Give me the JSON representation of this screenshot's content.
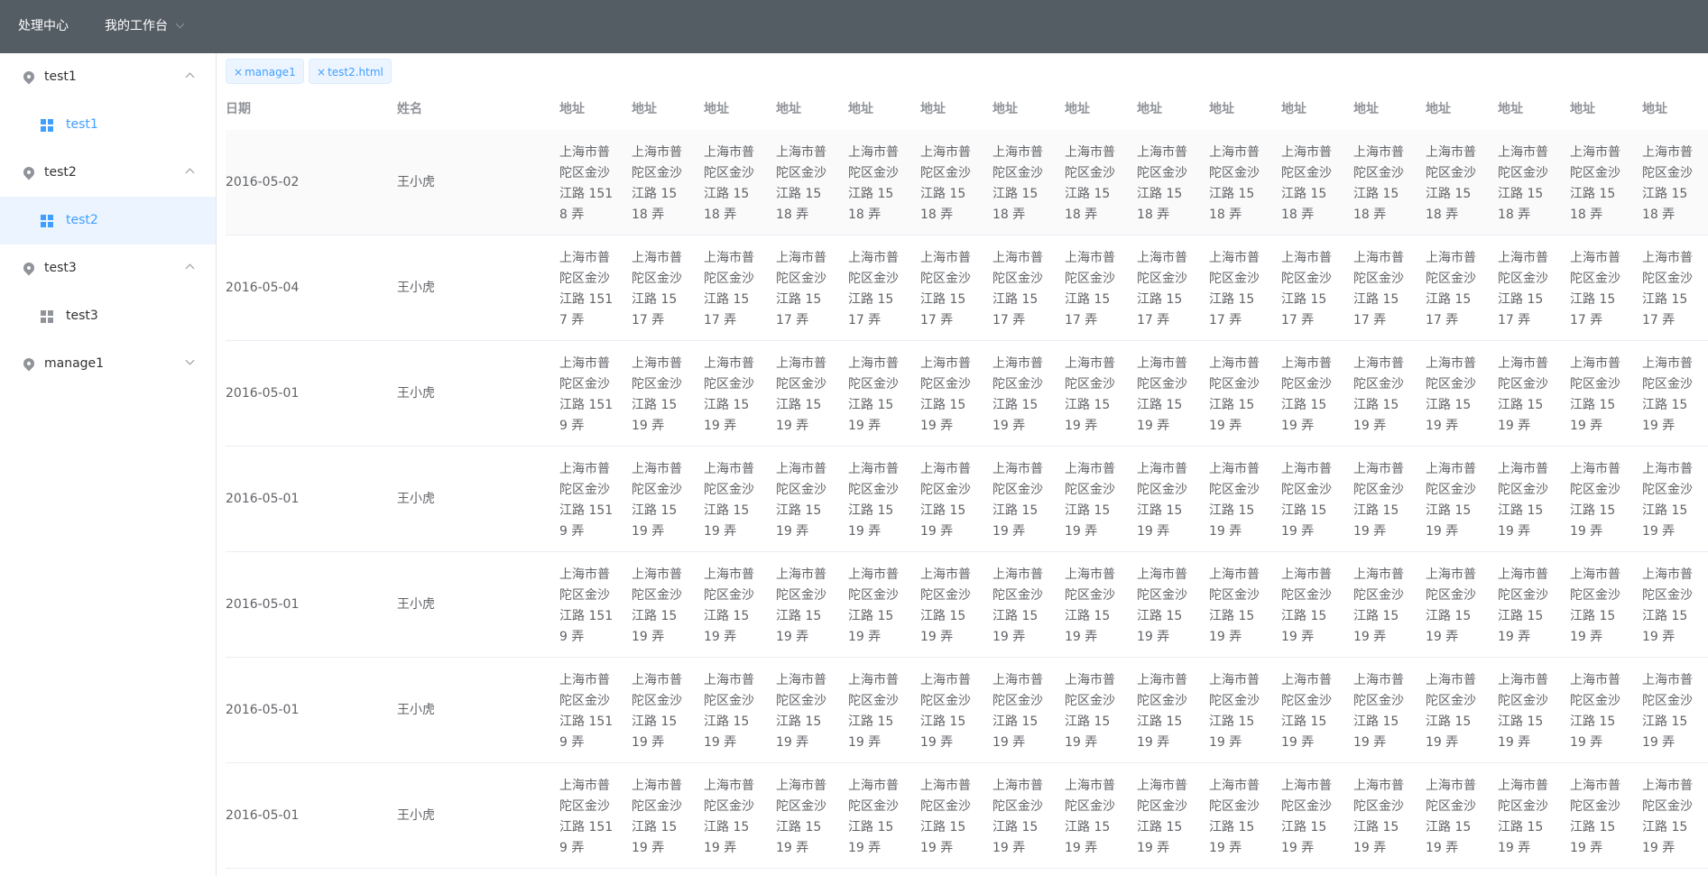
{
  "topnav": {
    "title": "处理中心",
    "workbench": "我的工作台"
  },
  "sidebar": {
    "groups": [
      {
        "label": "test1",
        "expanded": true,
        "items": [
          {
            "label": "test1",
            "active": false,
            "highlighted": true
          }
        ]
      },
      {
        "label": "test2",
        "expanded": true,
        "items": [
          {
            "label": "test2",
            "active": true,
            "highlighted": true
          }
        ]
      },
      {
        "label": "test3",
        "expanded": true,
        "items": [
          {
            "label": "test3",
            "active": false,
            "highlighted": false
          }
        ]
      },
      {
        "label": "manage1",
        "expanded": false,
        "items": []
      }
    ]
  },
  "tabs": [
    {
      "label": "manage1",
      "close_icon": "×"
    },
    {
      "label": "test2.html",
      "close_icon": "×"
    }
  ],
  "table": {
    "headers": {
      "date": "日期",
      "name": "姓名",
      "address": [
        "地址",
        "地址",
        "地址",
        "地址",
        "地址",
        "地址",
        "地址",
        "地址",
        "地址",
        "地址",
        "地址",
        "地址",
        "地址",
        "地址",
        "地址",
        "地址"
      ]
    },
    "rows": [
      {
        "date": "2016-05-02",
        "name": "王小虎",
        "address": [
          "上海市普陀区金沙江路 1518 弄",
          "上海市普陀区金沙江路 1518 弄",
          "上海市普陀区金沙江路 1518 弄",
          "上海市普陀区金沙江路 1518 弄",
          "上海市普陀区金沙江路 1518 弄",
          "上海市普陀区金沙江路 1518 弄",
          "上海市普陀区金沙江路 1518 弄",
          "上海市普陀区金沙江路 1518 弄",
          "上海市普陀区金沙江路 1518 弄",
          "上海市普陀区金沙江路 1518 弄",
          "上海市普陀区金沙江路 1518 弄",
          "上海市普陀区金沙江路 1518 弄",
          "上海市普陀区金沙江路 1518 弄",
          "上海市普陀区金沙江路 1518 弄",
          "上海市普陀区金沙江路 1518 弄",
          "上海市普陀区金沙江路 1518 弄"
        ]
      },
      {
        "date": "2016-05-04",
        "name": "王小虎",
        "address": [
          "上海市普陀区金沙江路 1517 弄",
          "上海市普陀区金沙江路 1517 弄",
          "上海市普陀区金沙江路 1517 弄",
          "上海市普陀区金沙江路 1517 弄",
          "上海市普陀区金沙江路 1517 弄",
          "上海市普陀区金沙江路 1517 弄",
          "上海市普陀区金沙江路 1517 弄",
          "上海市普陀区金沙江路 1517 弄",
          "上海市普陀区金沙江路 1517 弄",
          "上海市普陀区金沙江路 1517 弄",
          "上海市普陀区金沙江路 1517 弄",
          "上海市普陀区金沙江路 1517 弄",
          "上海市普陀区金沙江路 1517 弄",
          "上海市普陀区金沙江路 1517 弄",
          "上海市普陀区金沙江路 1517 弄",
          "上海市普陀区金沙江路 1517 弄"
        ]
      },
      {
        "date": "2016-05-01",
        "name": "王小虎",
        "address": [
          "上海市普陀区金沙江路 1519 弄",
          "上海市普陀区金沙江路 1519 弄",
          "上海市普陀区金沙江路 1519 弄",
          "上海市普陀区金沙江路 1519 弄",
          "上海市普陀区金沙江路 1519 弄",
          "上海市普陀区金沙江路 1519 弄",
          "上海市普陀区金沙江路 1519 弄",
          "上海市普陀区金沙江路 1519 弄",
          "上海市普陀区金沙江路 1519 弄",
          "上海市普陀区金沙江路 1519 弄",
          "上海市普陀区金沙江路 1519 弄",
          "上海市普陀区金沙江路 1519 弄",
          "上海市普陀区金沙江路 1519 弄",
          "上海市普陀区金沙江路 1519 弄",
          "上海市普陀区金沙江路 1519 弄",
          "上海市普陀区金沙江路 1519 弄"
        ]
      },
      {
        "date": "2016-05-01",
        "name": "王小虎",
        "address": [
          "上海市普陀区金沙江路 1519 弄",
          "上海市普陀区金沙江路 1519 弄",
          "上海市普陀区金沙江路 1519 弄",
          "上海市普陀区金沙江路 1519 弄",
          "上海市普陀区金沙江路 1519 弄",
          "上海市普陀区金沙江路 1519 弄",
          "上海市普陀区金沙江路 1519 弄",
          "上海市普陀区金沙江路 1519 弄",
          "上海市普陀区金沙江路 1519 弄",
          "上海市普陀区金沙江路 1519 弄",
          "上海市普陀区金沙江路 1519 弄",
          "上海市普陀区金沙江路 1519 弄",
          "上海市普陀区金沙江路 1519 弄",
          "上海市普陀区金沙江路 1519 弄",
          "上海市普陀区金沙江路 1519 弄",
          "上海市普陀区金沙江路 1519 弄"
        ]
      },
      {
        "date": "2016-05-01",
        "name": "王小虎",
        "address": [
          "上海市普陀区金沙江路 1519 弄",
          "上海市普陀区金沙江路 1519 弄",
          "上海市普陀区金沙江路 1519 弄",
          "上海市普陀区金沙江路 1519 弄",
          "上海市普陀区金沙江路 1519 弄",
          "上海市普陀区金沙江路 1519 弄",
          "上海市普陀区金沙江路 1519 弄",
          "上海市普陀区金沙江路 1519 弄",
          "上海市普陀区金沙江路 1519 弄",
          "上海市普陀区金沙江路 1519 弄",
          "上海市普陀区金沙江路 1519 弄",
          "上海市普陀区金沙江路 1519 弄",
          "上海市普陀区金沙江路 1519 弄",
          "上海市普陀区金沙江路 1519 弄",
          "上海市普陀区金沙江路 1519 弄",
          "上海市普陀区金沙江路 1519 弄"
        ]
      },
      {
        "date": "2016-05-01",
        "name": "王小虎",
        "address": [
          "上海市普陀区金沙江路 1519 弄",
          "上海市普陀区金沙江路 1519 弄",
          "上海市普陀区金沙江路 1519 弄",
          "上海市普陀区金沙江路 1519 弄",
          "上海市普陀区金沙江路 1519 弄",
          "上海市普陀区金沙江路 1519 弄",
          "上海市普陀区金沙江路 1519 弄",
          "上海市普陀区金沙江路 1519 弄",
          "上海市普陀区金沙江路 1519 弄",
          "上海市普陀区金沙江路 1519 弄",
          "上海市普陀区金沙江路 1519 弄",
          "上海市普陀区金沙江路 1519 弄",
          "上海市普陀区金沙江路 1519 弄",
          "上海市普陀区金沙江路 1519 弄",
          "上海市普陀区金沙江路 1519 弄",
          "上海市普陀区金沙江路 1519 弄"
        ]
      },
      {
        "date": "2016-05-01",
        "name": "王小虎",
        "address": [
          "上海市普陀区金沙江路 1519 弄",
          "上海市普陀区金沙江路 1519 弄",
          "上海市普陀区金沙江路 1519 弄",
          "上海市普陀区金沙江路 1519 弄",
          "上海市普陀区金沙江路 1519 弄",
          "上海市普陀区金沙江路 1519 弄",
          "上海市普陀区金沙江路 1519 弄",
          "上海市普陀区金沙江路 1519 弄",
          "上海市普陀区金沙江路 1519 弄",
          "上海市普陀区金沙江路 1519 弄",
          "上海市普陀区金沙江路 1519 弄",
          "上海市普陀区金沙江路 1519 弄",
          "上海市普陀区金沙江路 1519 弄",
          "上海市普陀区金沙江路 1519 弄",
          "上海市普陀区金沙江路 1519 弄",
          "上海市普陀区金沙江路 1519 弄"
        ]
      }
    ]
  },
  "colors": {
    "topbar_bg": "#545c64",
    "accent": "#409eff",
    "active_bg": "#ecf5ff",
    "text": "#606266",
    "header_text": "#909399"
  }
}
